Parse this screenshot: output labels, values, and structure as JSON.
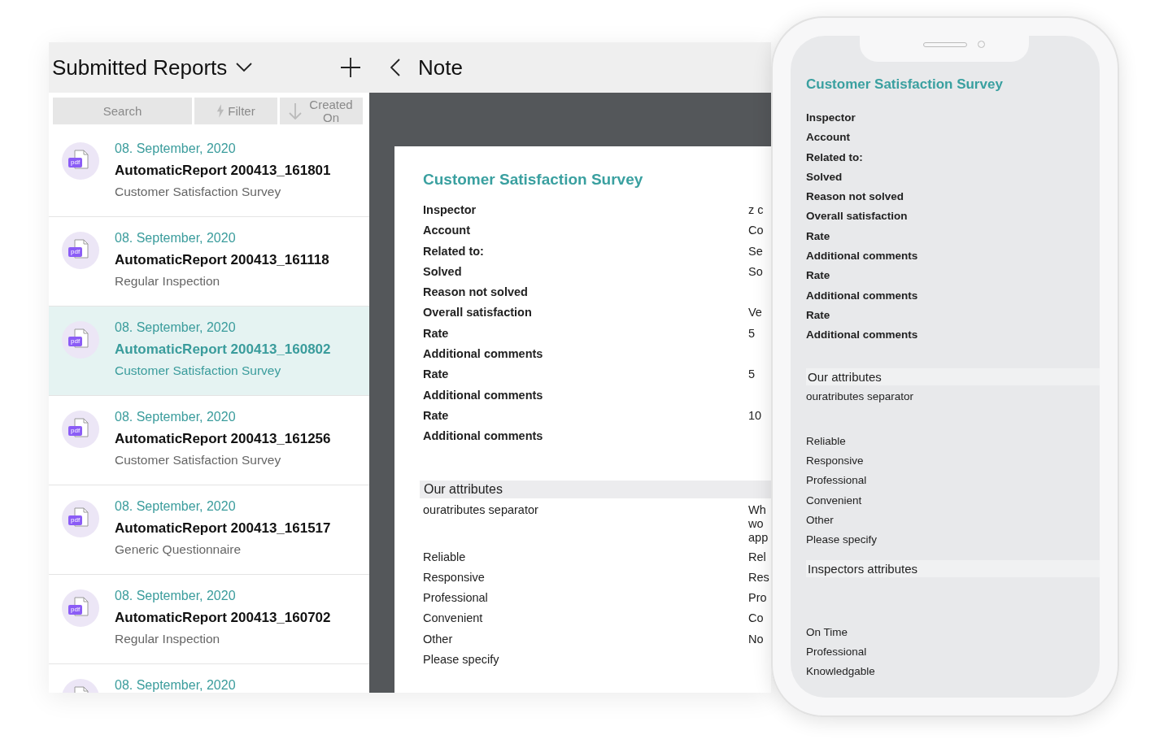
{
  "list_panel": {
    "title": "Submitted Reports",
    "toolbar": {
      "search_placeholder": "Search",
      "filter": "Filter",
      "sort": "Created On"
    },
    "reports": [
      {
        "date": "08. September, 2020",
        "name": "AutomaticReport 200413_161801",
        "type": "Customer Satisfaction Survey",
        "badge": "pdf",
        "selected": false
      },
      {
        "date": "08. September, 2020",
        "name": "AutomaticReport 200413_161118",
        "type": "Regular Inspection",
        "badge": "pdf",
        "selected": false
      },
      {
        "date": "08. September, 2020",
        "name": "AutomaticReport 200413_160802",
        "type": "Customer Satisfaction Survey",
        "badge": "pdf",
        "selected": true
      },
      {
        "date": "08. September, 2020",
        "name": "AutomaticReport 200413_161256",
        "type": "Customer Satisfaction Survey",
        "badge": "pdf",
        "selected": false
      },
      {
        "date": "08. September, 2020",
        "name": "AutomaticReport 200413_161517",
        "type": "Generic Questionnaire",
        "badge": "pdf",
        "selected": false
      },
      {
        "date": "08. September, 2020",
        "name": "AutomaticReport 200413_160702",
        "type": "Regular Inspection",
        "badge": "pdf",
        "selected": false
      },
      {
        "date": "08. September, 2020"
      }
    ]
  },
  "note_panel": {
    "title": "Note",
    "document": {
      "title": "Customer Satisfaction Survey",
      "fields": [
        {
          "label": "Inspector",
          "value": "z c"
        },
        {
          "label": "Account",
          "value": "Co"
        },
        {
          "label": "Related to:",
          "value": "Se"
        },
        {
          "label": "Solved",
          "value": "So"
        },
        {
          "label": "Reason not solved"
        },
        {
          "label": "Overall satisfaction",
          "value": "Ve"
        },
        {
          "label": "Rate",
          "value": "5"
        },
        {
          "label": "Additional comments"
        },
        {
          "label": "Rate",
          "value": "5"
        },
        {
          "label": "Additional comments"
        },
        {
          "label": "Rate",
          "value": "10"
        },
        {
          "label": "Additional comments"
        }
      ],
      "section": {
        "title": "Our attributes",
        "separator": {
          "label": "ouratributes separator",
          "value_lines": [
            "Wh",
            "wo",
            "app"
          ]
        },
        "rows": [
          {
            "label": "Reliable",
            "value": "Rel"
          },
          {
            "label": "Responsive",
            "value": "Res"
          },
          {
            "label": "Professional",
            "value": "Pro"
          },
          {
            "label": "Convenient",
            "value": "Co"
          },
          {
            "label": "Other",
            "value": "No"
          },
          {
            "label": "Please specify"
          }
        ]
      }
    }
  },
  "phone": {
    "title": "Customer Satisfaction Survey",
    "fields": [
      "Inspector",
      "Account",
      "Related to:",
      "Solved",
      "Reason not solved",
      "Overall satisfaction",
      "Rate",
      "Additional comments",
      "Rate",
      "Additional comments",
      "Rate",
      "Additional comments"
    ],
    "sections": [
      {
        "title": "Our attributes",
        "separator": "ouratributes separator",
        "rows": [
          "Reliable",
          "Responsive",
          "Professional",
          "Convenient",
          "Other",
          "Please specify"
        ]
      },
      {
        "title": "Inspectors attributes",
        "rows": [
          "On Time",
          "Professional",
          "Knowledgable"
        ]
      }
    ]
  }
}
